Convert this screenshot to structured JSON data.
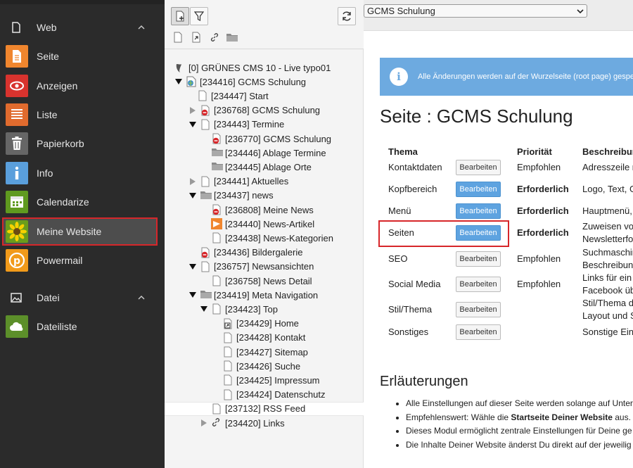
{
  "modmenu": {
    "groups": [
      {
        "label": "Web",
        "icon": "file-icon"
      },
      {
        "label": "Datei",
        "icon": "image-icon"
      }
    ],
    "web_modules": [
      {
        "label": "Seite",
        "icon": "page-icon",
        "color": "#f0862e"
      },
      {
        "label": "Anzeigen",
        "icon": "eye-icon",
        "color": "#d8332e"
      },
      {
        "label": "Liste",
        "icon": "list-icon",
        "color": "#e06b2e"
      },
      {
        "label": "Papierkorb",
        "icon": "trash-icon",
        "color": "#666666"
      },
      {
        "label": "Info",
        "icon": "info-icon",
        "color": "#5a9fdc"
      },
      {
        "label": "Calendarize",
        "icon": "calendar-icon",
        "color": "#5f9a1f"
      },
      {
        "label": "Meine Website",
        "icon": "sunflower-icon",
        "color": "#6a9d1b"
      },
      {
        "label": "Powermail",
        "icon": "powermail-icon",
        "color": "#f19a1a"
      }
    ],
    "file_modules": [
      {
        "label": "Dateiliste",
        "icon": "cloud-icon",
        "color": "#5c8f2a"
      }
    ]
  },
  "tree": {
    "rows": [
      {
        "label": "[0] GRÜNES CMS 10 - Live typo01",
        "icon": "typo3-icon",
        "toggle": ""
      },
      {
        "label": "[234416] GCMS Schulung",
        "icon": "root-globe-icon",
        "toggle": "open"
      },
      {
        "label": "[234447] Start",
        "icon": "page-icon",
        "toggle": ""
      },
      {
        "label": "[236768] GCMS Schulung",
        "icon": "page-disabled-icon",
        "toggle": "closed"
      },
      {
        "label": "[234443] Termine",
        "icon": "page-icon",
        "toggle": "open"
      },
      {
        "label": "[236770] GCMS Schulung",
        "icon": "page-disabled-icon",
        "toggle": ""
      },
      {
        "label": "[234446] Ablage Termine",
        "icon": "folder-icon",
        "toggle": ""
      },
      {
        "label": "[234445] Ablage Orte",
        "icon": "folder-icon",
        "toggle": ""
      },
      {
        "label": "[234441] Aktuelles",
        "icon": "page-icon",
        "toggle": "closed"
      },
      {
        "label": "[234437] news",
        "icon": "folder-icon",
        "toggle": "open"
      },
      {
        "label": "[236808] Meine News",
        "icon": "page-disabled-icon",
        "toggle": ""
      },
      {
        "label": "[234440] News-Artikel",
        "icon": "news-plugin-icon",
        "toggle": ""
      },
      {
        "label": "[234438] News-Kategorien",
        "icon": "page-icon",
        "toggle": ""
      },
      {
        "label": "[234436] Bildergalerie",
        "icon": "page-disabled-icon",
        "toggle": ""
      },
      {
        "label": "[236757] Newsansichten",
        "icon": "page-icon",
        "toggle": "open"
      },
      {
        "label": "[236758] News Detail",
        "icon": "page-icon",
        "toggle": ""
      },
      {
        "label": "[234419] Meta Navigation",
        "icon": "folder-icon",
        "toggle": "open"
      },
      {
        "label": "[234423] Top",
        "icon": "page-icon",
        "toggle": "open"
      },
      {
        "label": "[234429] Home",
        "icon": "shortcut-icon",
        "toggle": ""
      },
      {
        "label": "[234428] Kontakt",
        "icon": "page-icon",
        "toggle": ""
      },
      {
        "label": "[234427] Sitemap",
        "icon": "page-icon",
        "toggle": ""
      },
      {
        "label": "[234426] Suche",
        "icon": "page-icon",
        "toggle": ""
      },
      {
        "label": "[234425] Impressum",
        "icon": "page-icon",
        "toggle": ""
      },
      {
        "label": "[234424] Datenschutz",
        "icon": "page-icon",
        "toggle": ""
      },
      {
        "label": "[237132] RSS Feed",
        "icon": "page-icon",
        "toggle": ""
      },
      {
        "label": "[234420] Links",
        "icon": "link-icon",
        "toggle": "closed"
      }
    ]
  },
  "content": {
    "site_select": "GCMS Schulung",
    "info_text": "Alle Änderungen werden auf der Wurzelseite (root page) gespe",
    "title": "Seite : GCMS Schulung",
    "headers": {
      "thema": "Thema",
      "prio": "Priorität",
      "desc": "Beschreibun"
    },
    "rows": [
      {
        "thema": "Kontaktdaten",
        "button": "Bearbeiten",
        "primary": false,
        "prio": "Empfohlen",
        "prio_bold": false,
        "desc1": "Adresszeile m",
        "desc2": ""
      },
      {
        "thema": "Kopfbereich",
        "button": "Bearbeiten",
        "primary": true,
        "prio": "Erforderlich",
        "prio_bold": true,
        "desc1": "Logo, Text, G",
        "desc2": ""
      },
      {
        "thema": "Menü",
        "button": "Bearbeiten",
        "primary": true,
        "prio": "Erforderlich",
        "prio_bold": true,
        "desc1": "Hauptmenü, C",
        "desc2": ""
      },
      {
        "thema": "Seiten",
        "button": "Bearbeiten",
        "primary": true,
        "prio": "Erforderlich",
        "prio_bold": true,
        "desc1": "Zuweisen vor",
        "desc2": "Newsletterfor"
      },
      {
        "thema": "SEO",
        "button": "Bearbeiten",
        "primary": false,
        "prio": "Empfohlen",
        "prio_bold": false,
        "desc1": "Suchmaschin",
        "desc2": "Beschreibung"
      },
      {
        "thema": "Social Media",
        "button": "Bearbeiten",
        "primary": false,
        "prio": "Empfohlen",
        "prio_bold": false,
        "desc1": "Links für ein D",
        "desc2": "Facebook übe"
      },
      {
        "thema": "Stil/Thema",
        "button": "Bearbeiten",
        "primary": false,
        "prio": "",
        "prio_bold": false,
        "desc1": "Stil/Thema de",
        "desc2": "Layout und S"
      },
      {
        "thema": "Sonstiges",
        "button": "Bearbeiten",
        "primary": false,
        "prio": "",
        "prio_bold": false,
        "desc1": "Sonstige Eins",
        "desc2": ""
      }
    ],
    "notes_title": "Erläuterungen",
    "notes": [
      {
        "pre": "Alle Einstellungen auf dieser Seite werden solange auf Unter",
        "bold": "",
        "post": ""
      },
      {
        "pre": "Empfehlenswert: Wähle die ",
        "bold": "Startseite Deiner Website",
        "post": " aus."
      },
      {
        "pre": "Dieses Modul ermöglicht zentrale Einstellungen für Deine ge",
        "bold": "",
        "post": ""
      },
      {
        "pre": "Die Inhalte Deiner Website änderst Du direkt auf der jeweilig",
        "bold": "",
        "post": ""
      }
    ]
  }
}
